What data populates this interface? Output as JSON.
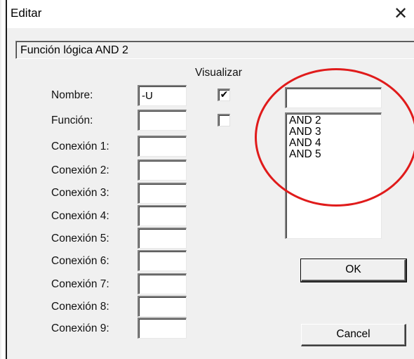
{
  "window": {
    "title": "Editar",
    "close_icon": "close-icon"
  },
  "header": {
    "text": "Función lógica AND 2"
  },
  "visualizar_label": "Visualizar",
  "fields": [
    {
      "label": "Nombre:",
      "value": "-U",
      "visible_checked": true
    },
    {
      "label": "Función:",
      "value": "",
      "visible_checked": false
    },
    {
      "label": "Conexión 1:",
      "value": ""
    },
    {
      "label": "Conexión 2:",
      "value": ""
    },
    {
      "label": "Conexión 3:",
      "value": ""
    },
    {
      "label": "Conexión 4:",
      "value": ""
    },
    {
      "label": "Conexión 5:",
      "value": ""
    },
    {
      "label": "Conexión 6:",
      "value": ""
    },
    {
      "label": "Conexión 7:",
      "value": ""
    },
    {
      "label": "Conexión 8:",
      "value": ""
    },
    {
      "label": "Conexión 9:",
      "value": ""
    }
  ],
  "list": {
    "search_value": "",
    "items": [
      "AND 2",
      "AND 3",
      "AND 4",
      "AND 5"
    ]
  },
  "buttons": {
    "ok": "OK",
    "cancel": "Cancel"
  },
  "annotation": {
    "color": "#e01b1b"
  }
}
